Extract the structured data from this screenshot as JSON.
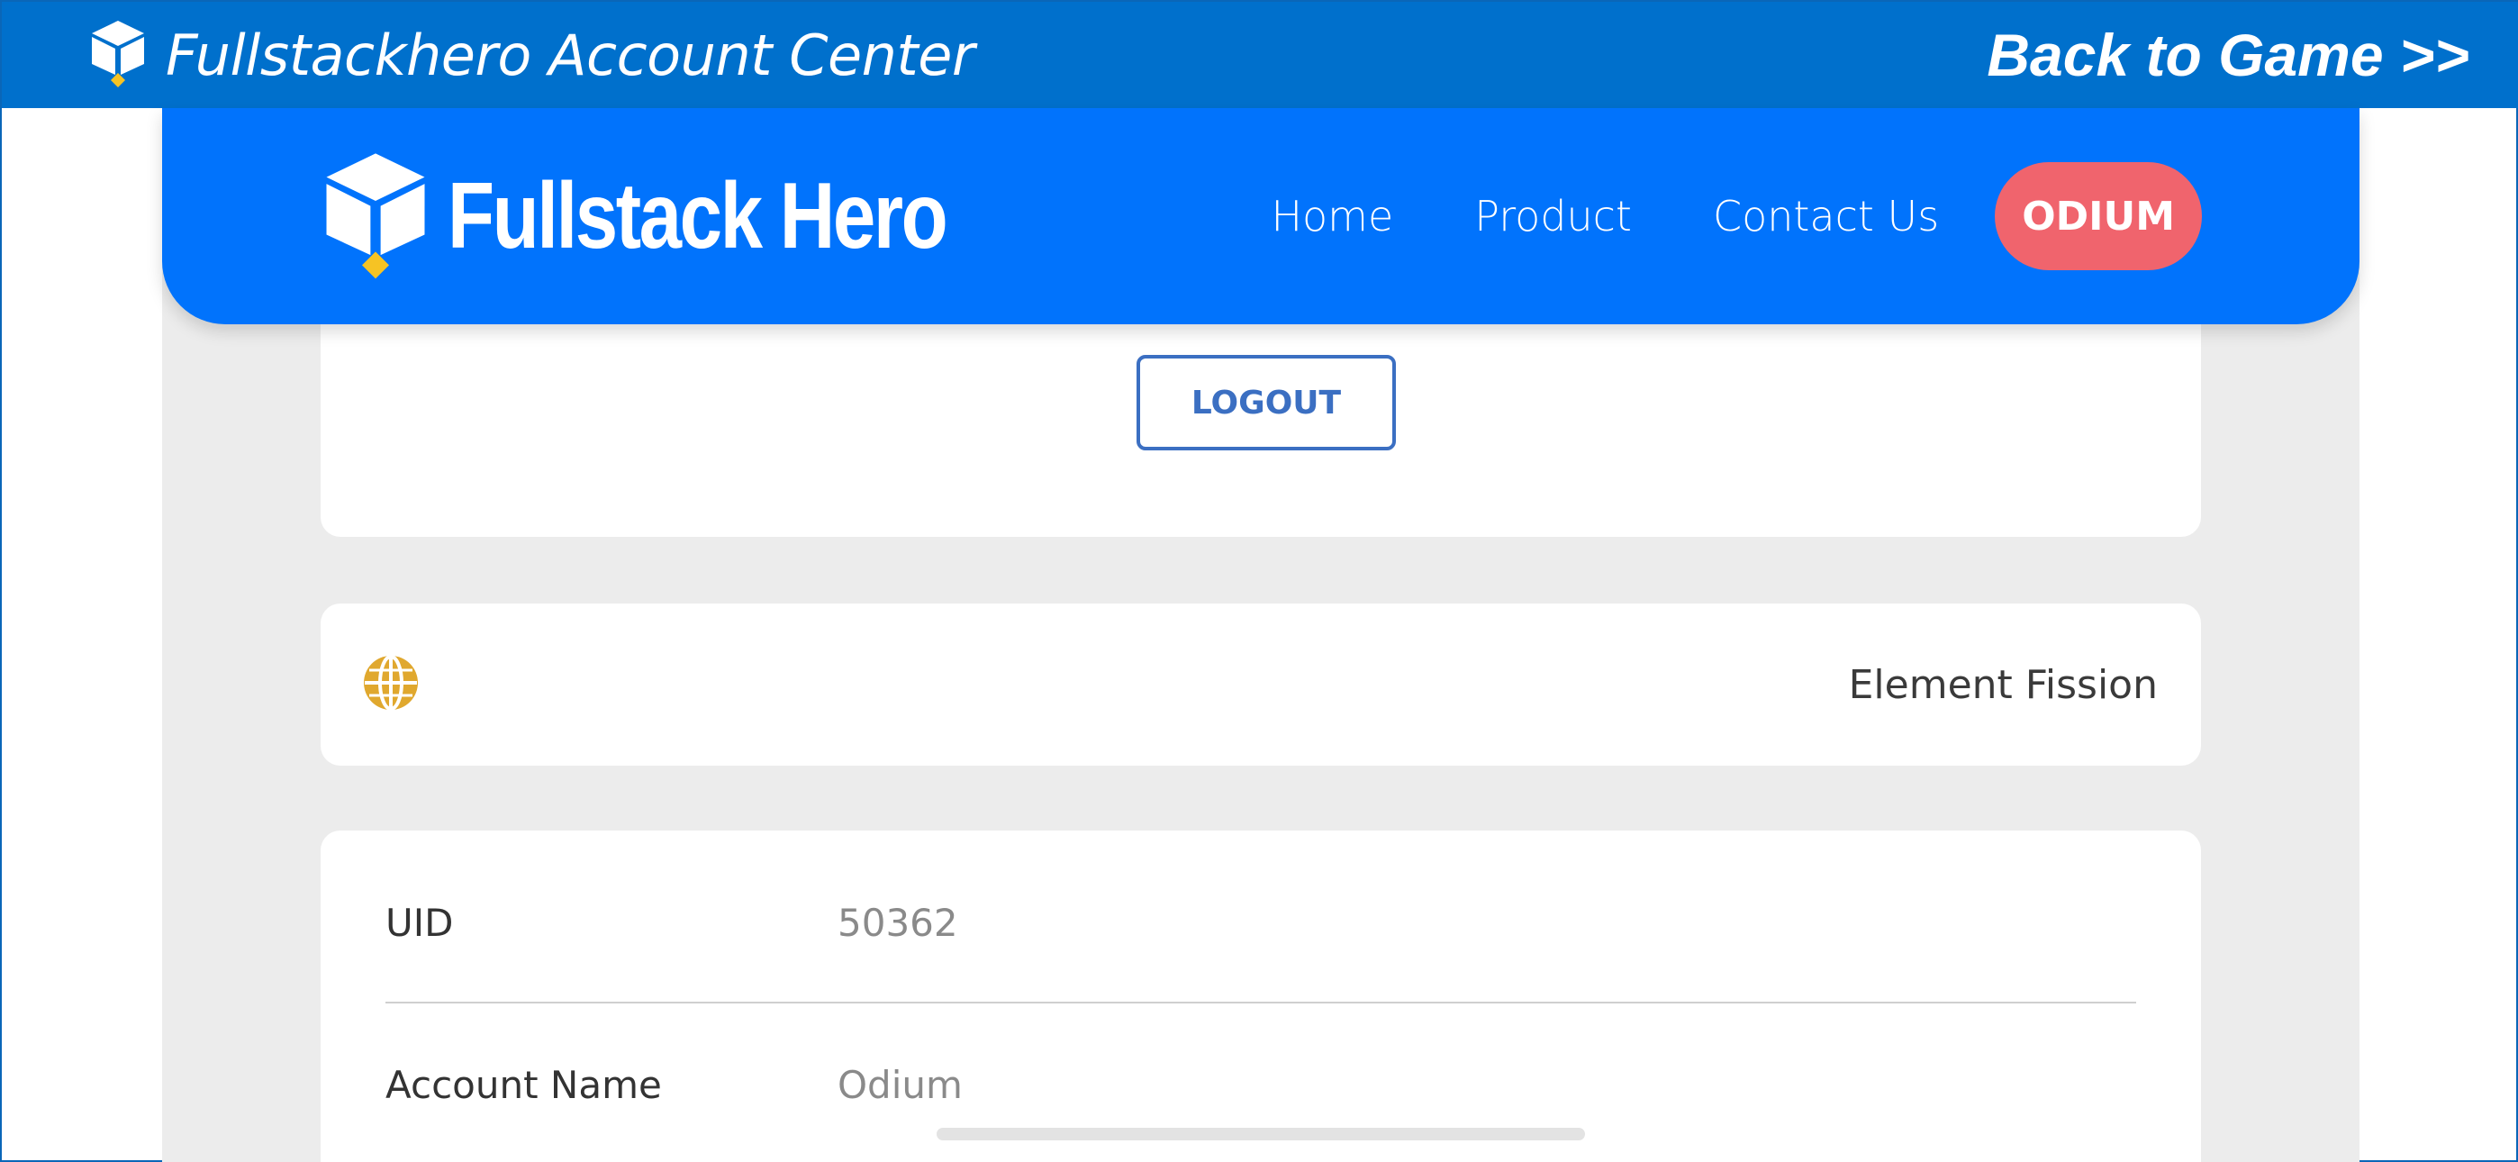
{
  "topbar": {
    "title": "Fullstackhero Account Center",
    "back_label": "Back to Game >>"
  },
  "navbar": {
    "brand": "Fullstack Hero",
    "links": [
      {
        "label": "Home"
      },
      {
        "label": "Product"
      },
      {
        "label": "Contact Us"
      }
    ],
    "user_label": "ODIUM"
  },
  "logout": {
    "label": "LOGOUT"
  },
  "server": {
    "icon": "globe-icon",
    "name": "Element Fission"
  },
  "account": {
    "rows": [
      {
        "label": "UID",
        "value": "50362"
      },
      {
        "label": "Account Name",
        "value": "Odium"
      }
    ]
  },
  "colors": {
    "topbar": "#0070cc",
    "navbar": "#0173fc",
    "user_badge": "#f0646d",
    "logout_border": "#3b6fc2",
    "globe": "#e0a82e"
  }
}
